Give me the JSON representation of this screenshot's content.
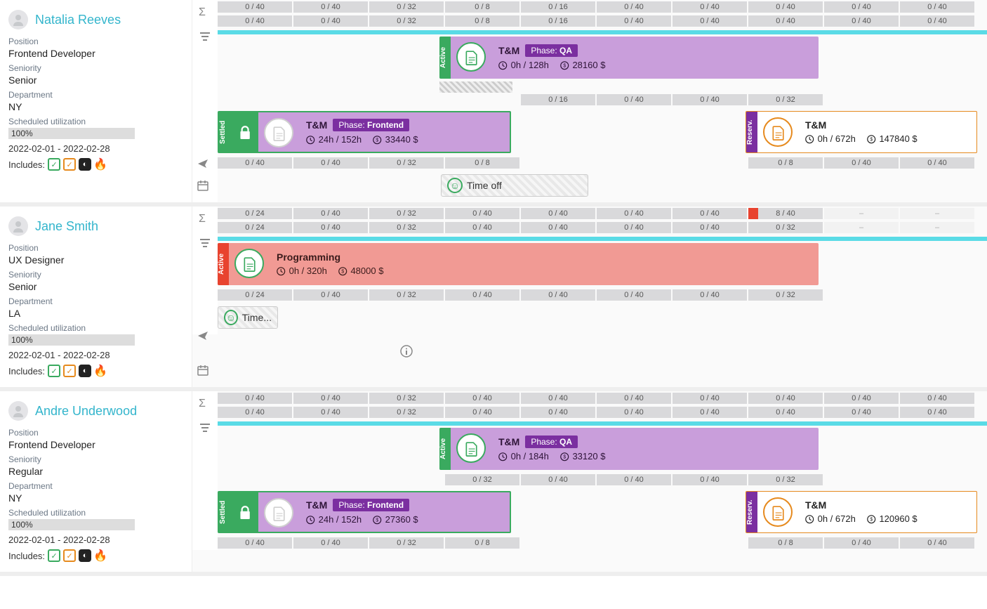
{
  "labels": {
    "position": "Position",
    "seniority": "Seniority",
    "department": "Department",
    "utilization": "Scheduled utilization",
    "includes": "Includes:"
  },
  "status": {
    "active": "Active",
    "settled": "Settled",
    "reserv": "Reserv."
  },
  "phasePrefix": "Phase:",
  "timeoff_label": "Time off",
  "timeoff_short": "Time...",
  "people": [
    {
      "name": "Natalia Reeves",
      "position": "Frontend Developer",
      "seniority": "Senior",
      "department": "NY",
      "utilization": "100%",
      "range": "2022-02-01 - 2022-02-28",
      "summary_top": [
        "0 / 40",
        "0 / 40",
        "0 / 32",
        "0 / 8",
        "0 / 16",
        "0 / 40",
        "0 / 40",
        "0 / 40",
        "0 / 40",
        "0 / 40"
      ],
      "summary_bottom": [
        "0 / 40",
        "0 / 40",
        "0 / 32",
        "0 / 8",
        "0 / 16",
        "0 / 40",
        "0 / 40",
        "0 / 40",
        "0 / 40",
        "0 / 40"
      ],
      "track1_alloc": [
        "",
        "",
        "",
        "",
        "0 / 16",
        "0 / 40",
        "0 / 40",
        "0 / 32",
        "",
        ""
      ],
      "track1_block": {
        "title": "T&M",
        "phase": "QA",
        "hours": "0h / 128h",
        "cost": "28160 $",
        "status": "Active"
      },
      "track2_alloc": [
        "0 / 40",
        "0 / 40",
        "0 / 32",
        "0 / 8",
        "",
        "",
        "",
        "0 / 8",
        "0 / 40",
        "0 / 40"
      ],
      "track2_block": {
        "title": "T&M",
        "phase": "Frontend",
        "hours": "24h / 152h",
        "cost": "33440 $",
        "status": "Settled"
      },
      "track2_block_r": {
        "title": "T&M",
        "hours": "0h / 672h",
        "cost": "147840 $",
        "status": "Reserv."
      }
    },
    {
      "name": "Jane Smith",
      "position": "UX Designer",
      "seniority": "Senior",
      "department": "LA",
      "utilization": "100%",
      "range": "2022-02-01 - 2022-02-28",
      "summary_top": [
        "0 / 24",
        "0 / 40",
        "0 / 32",
        "0 / 40",
        "0 / 40",
        "0 / 40",
        "0 / 40",
        "8 / 40",
        "–",
        "–"
      ],
      "summary_bottom": [
        "0 / 24",
        "0 / 40",
        "0 / 32",
        "0 / 40",
        "0 / 40",
        "0 / 40",
        "0 / 40",
        "0 / 32",
        "–",
        "–"
      ],
      "track1_alloc": [
        "0 / 24",
        "0 / 40",
        "0 / 32",
        "0 / 40",
        "0 / 40",
        "0 / 40",
        "0 / 40",
        "0 / 32",
        "",
        ""
      ],
      "track1_block": {
        "title": "Programming",
        "hours": "0h / 320h",
        "cost": "48000 $",
        "status": "Active"
      }
    },
    {
      "name": "Andre Underwood",
      "position": "Frontend Developer",
      "seniority": "Regular",
      "department": "NY",
      "utilization": "100%",
      "range": "2022-02-01 - 2022-02-28",
      "summary_top": [
        "0 / 40",
        "0 / 40",
        "0 / 32",
        "0 / 40",
        "0 / 40",
        "0 / 40",
        "0 / 40",
        "0 / 40",
        "0 / 40",
        "0 / 40"
      ],
      "summary_bottom": [
        "0 / 40",
        "0 / 40",
        "0 / 32",
        "0 / 40",
        "0 / 40",
        "0 / 40",
        "0 / 40",
        "0 / 40",
        "0 / 40",
        "0 / 40"
      ],
      "track1_alloc": [
        "",
        "",
        "",
        "0 / 32",
        "0 / 40",
        "0 / 40",
        "0 / 40",
        "0 / 32",
        "",
        ""
      ],
      "track1_block": {
        "title": "T&M",
        "phase": "QA",
        "hours": "0h / 184h",
        "cost": "33120 $",
        "status": "Active"
      },
      "track2_alloc": [
        "0 / 40",
        "0 / 40",
        "0 / 32",
        "0 / 8",
        "",
        "",
        "",
        "0 / 8",
        "0 / 40",
        "0 / 40"
      ],
      "track2_block": {
        "title": "T&M",
        "phase": "Frontend",
        "hours": "24h / 152h",
        "cost": "27360 $",
        "status": "Settled"
      },
      "track2_block_r": {
        "title": "T&M",
        "hours": "0h / 672h",
        "cost": "120960 $",
        "status": "Reserv."
      }
    }
  ]
}
